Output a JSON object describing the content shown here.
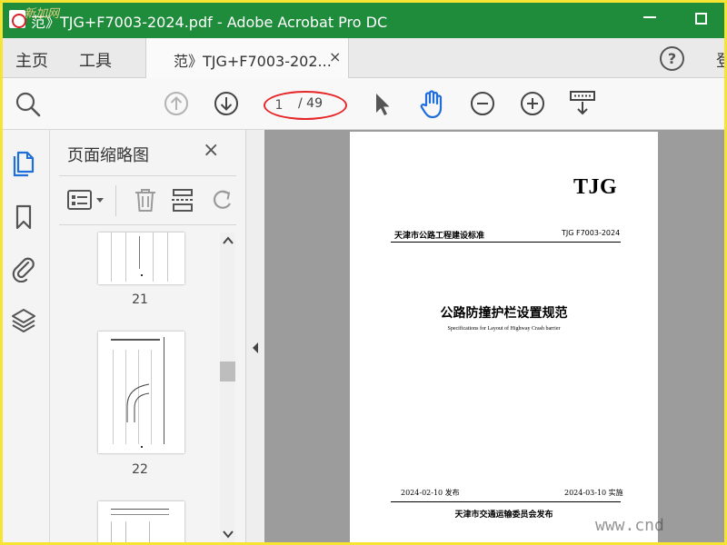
{
  "window": {
    "title": "范》TJG+F7003-2024.pdf - Adobe Acrobat Pro DC",
    "watermark": "新加网"
  },
  "menu": {
    "home": "主页",
    "tools": "工具",
    "doc_tab": "范》TJG+F7003-202...",
    "doc_tab_close": "×",
    "help": "?",
    "signin_partial": "登"
  },
  "toolbar": {
    "current_page": "1",
    "total_pages": "/ 49",
    "annotation_color": "#e5262a"
  },
  "thumbnails_panel": {
    "title": "页面缩略图",
    "close": "×",
    "pages": [
      {
        "label": "21"
      },
      {
        "label": "22"
      }
    ]
  },
  "document": {
    "brand": "TJG",
    "issuer": "天津市公路工程建设标准",
    "standard_number": "TJG F7003-2024",
    "title_cn": "公路防撞护栏设置规范",
    "title_en": "Specifications for Layout of Highway Crash barrier",
    "issue_date": "2024-02-10 发布",
    "implementation_date": "2024-03-10 实施",
    "publisher": "天津市交通运输委员会发布"
  },
  "site_watermark": "www.cnd",
  "colors": {
    "titlebar": "#1f8c3c",
    "hand_tool_active": "#1e6fd9",
    "frame": "#f5e431"
  }
}
